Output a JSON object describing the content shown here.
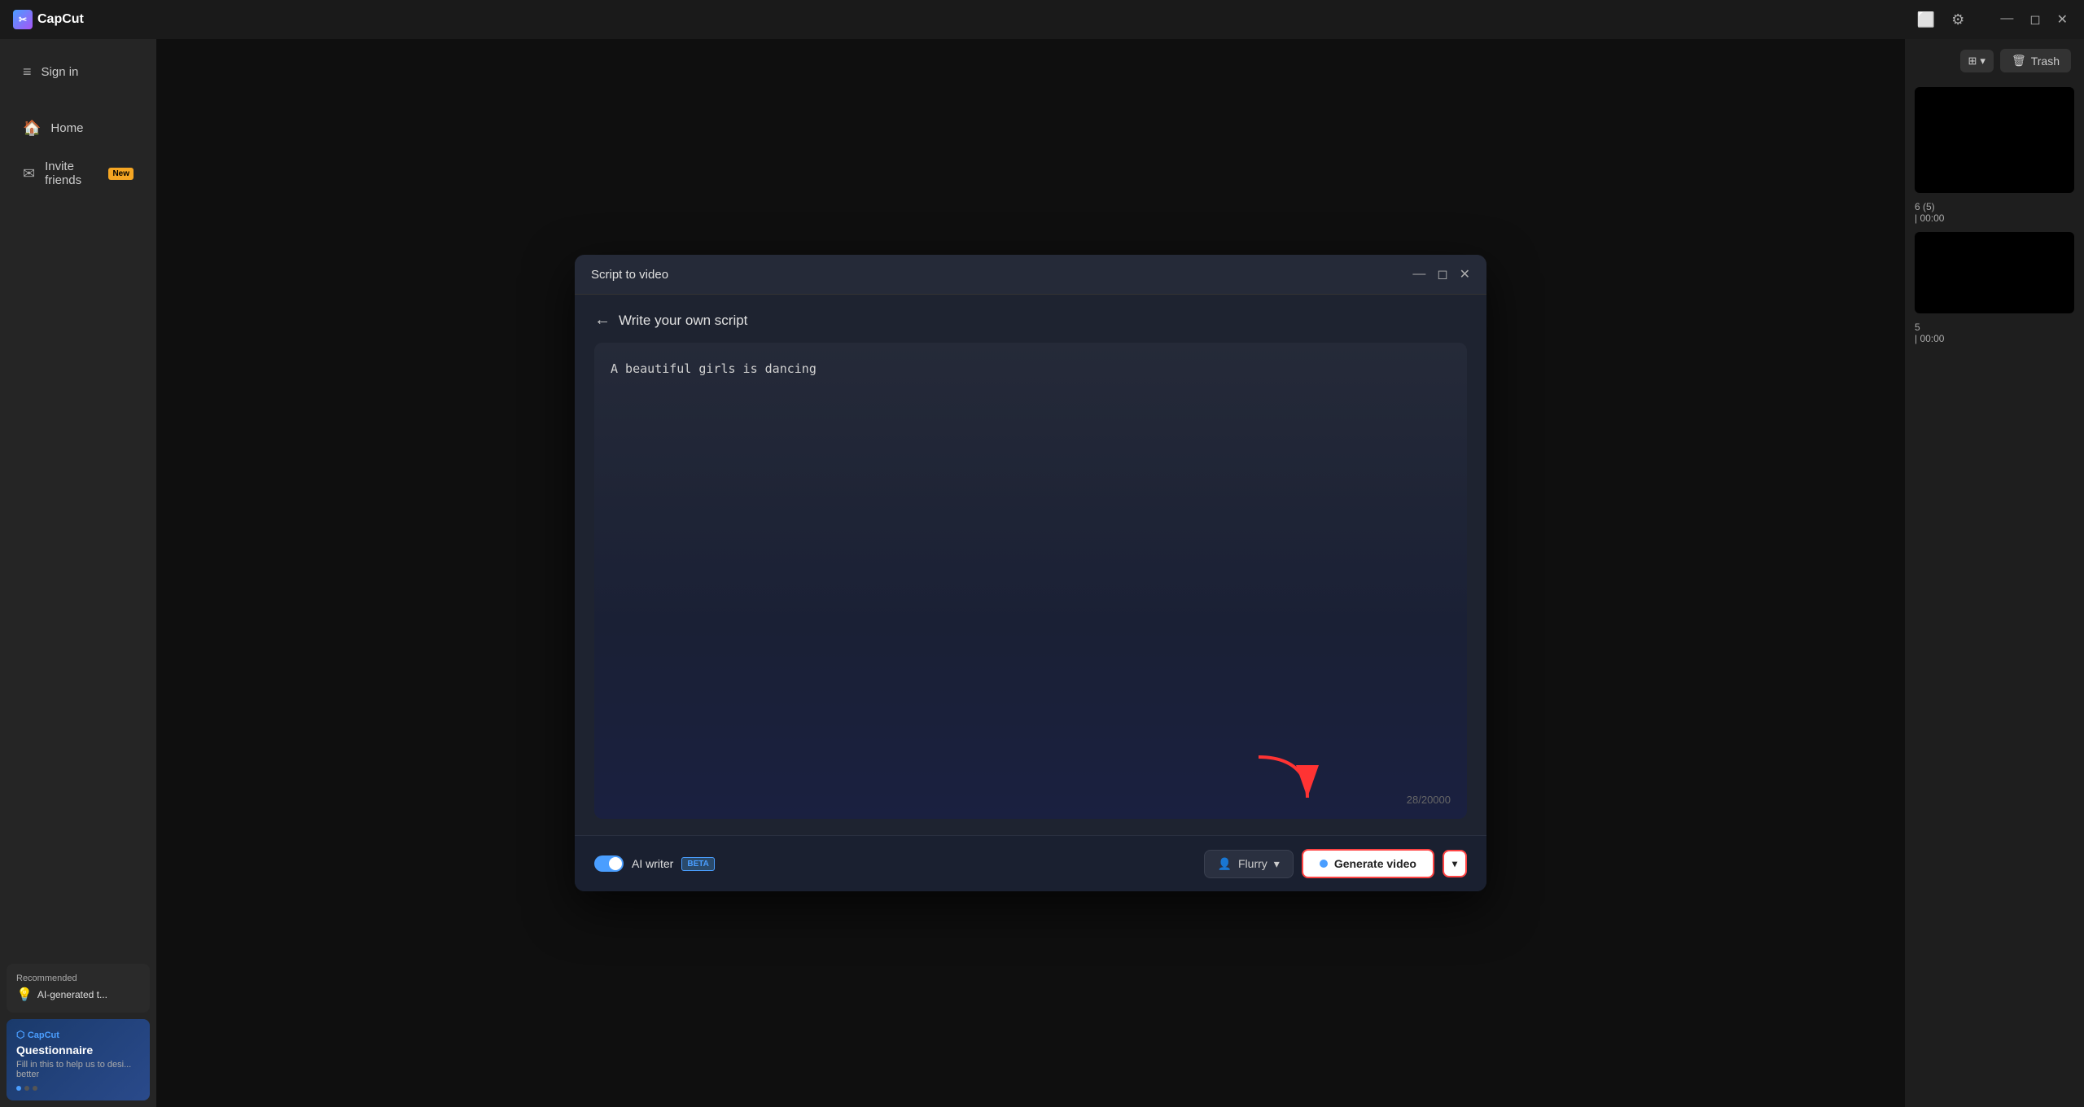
{
  "app": {
    "name": "CapCut",
    "logo_icon": "✂"
  },
  "title_bar": {
    "icons": [
      "monitor-icon",
      "gear-icon",
      "minimize-icon",
      "maximize-icon",
      "close-icon"
    ]
  },
  "sidebar": {
    "sign_in_label": "Sign in",
    "items": [
      {
        "id": "home",
        "label": "Home",
        "icon": "🏠",
        "badge": null
      },
      {
        "id": "invite",
        "label": "Invite friends",
        "icon": "✉",
        "badge": "New"
      }
    ],
    "recommended": {
      "label": "Recommended",
      "text": "AI-generated t..."
    },
    "promo": {
      "logo": "CapCut",
      "title": "Questionnaire",
      "text": "Fill in this to help us to desi... better"
    }
  },
  "right_panel": {
    "grid_label": "⊞",
    "trash_label": "Trash",
    "media_items": [
      {
        "info": "6 (5)",
        "duration": "| 00:00"
      },
      {
        "info": "5",
        "duration": "| 00:00"
      }
    ]
  },
  "modal": {
    "title": "Script to video",
    "back_label": "Write your own script",
    "script_content": "A beautiful girls is dancing",
    "char_count": "28/20000",
    "ai_writer_label": "AI writer",
    "beta_label": "BETA",
    "voice_label": "Flurry",
    "generate_label": "Generate video",
    "generate_dropdown_icon": "▾",
    "toggle_on": true
  }
}
